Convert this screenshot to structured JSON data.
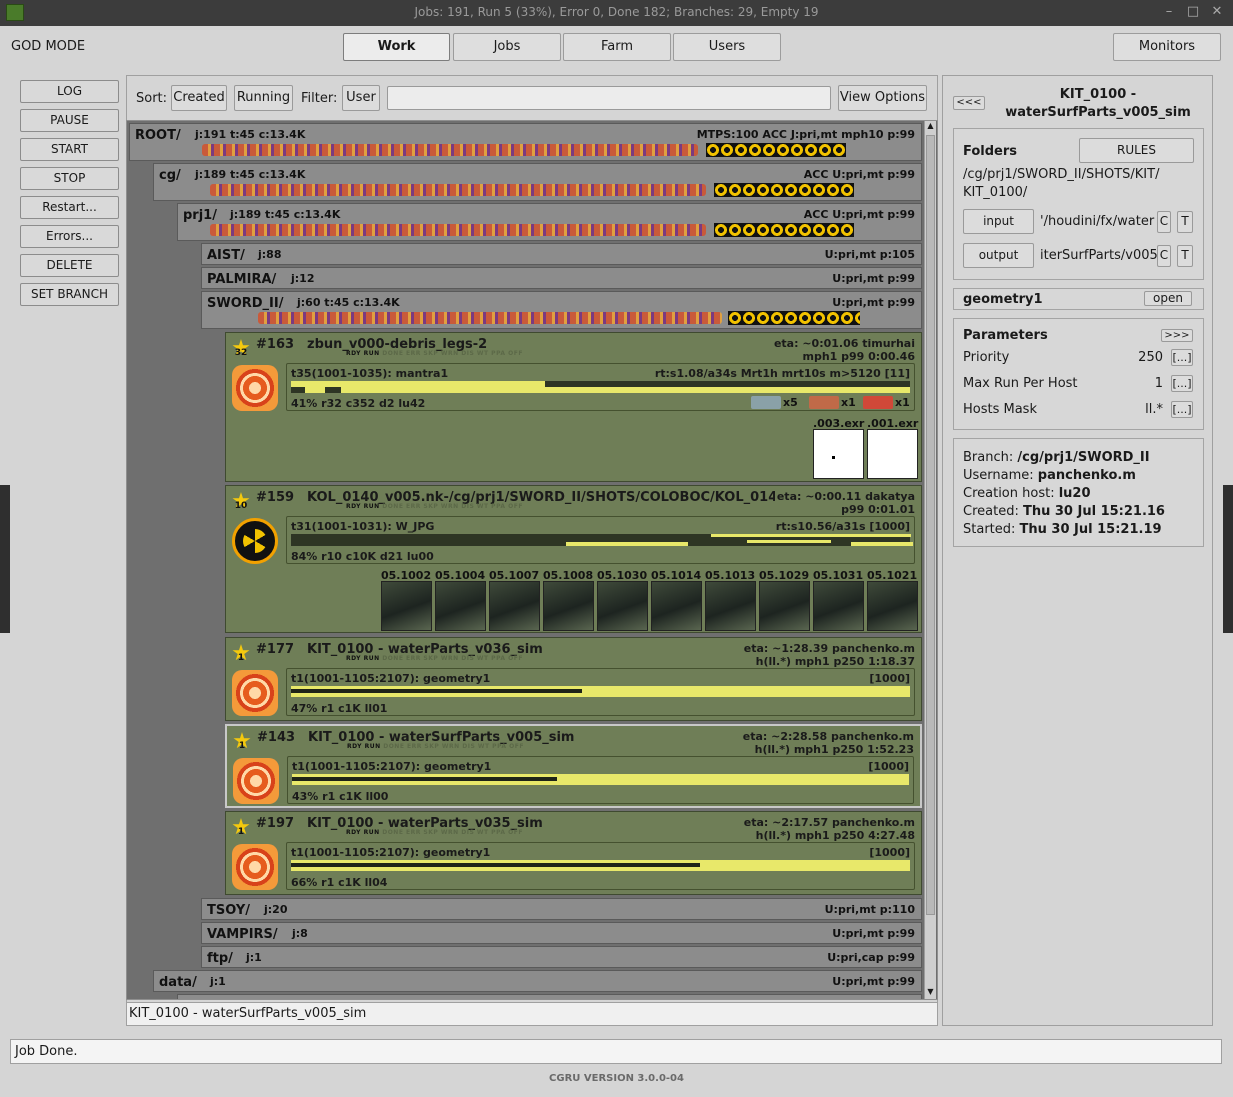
{
  "window": {
    "title": "Jobs: 191, Run 5 (33%), Error 0, Done 182; Branches: 29, Empty 19"
  },
  "header": {
    "mode_label": "GOD MODE",
    "tabs": [
      "Work",
      "Jobs",
      "Farm",
      "Users"
    ],
    "monitors_label": "Monitors"
  },
  "sidebar": {
    "buttons": [
      "LOG",
      "PAUSE",
      "START",
      "STOP",
      "Restart...",
      "Errors...",
      "DELETE",
      "SET BRANCH"
    ]
  },
  "toolbar": {
    "sort_label": "Sort:",
    "sort_created": "Created",
    "sort_running": "Running",
    "filter_label": "Filter:",
    "filter_user": "User",
    "filter_value": "",
    "view_options": "View Options"
  },
  "branches": {
    "root": {
      "name": "ROOT/",
      "info": "j:191 t:45 c:13.4K",
      "right": "MTPS:100 ACC J:pri,mt mph10 p:99"
    },
    "cg": {
      "name": "cg/",
      "info": "j:189 t:45 c:13.4K",
      "right": "ACC U:pri,mt p:99"
    },
    "prj1": {
      "name": "prj1/",
      "info": "j:189 t:45 c:13.4K",
      "right": "ACC U:pri,mt p:99"
    },
    "aist": {
      "name": "AIST/",
      "info": "j:88",
      "right": "U:pri,mt p:105"
    },
    "palmira": {
      "name": "PALMIRA/",
      "info": "j:12",
      "right": "U:pri,mt p:99"
    },
    "sword": {
      "name": "SWORD_II/",
      "info": "j:60 t:45 c:13.4K",
      "right": "U:pri,mt p:99"
    },
    "tsoy": {
      "name": "TSOY/",
      "info": "j:20",
      "right": "U:pri,mt p:110"
    },
    "vampirs": {
      "name": "VAMPIRS/",
      "info": "j:8",
      "right": "U:pri,mt p:99"
    },
    "ftp": {
      "name": "ftp/",
      "info": "j:1",
      "right": "U:pri,cap p:99"
    },
    "data": {
      "name": "data/",
      "info": "j:1",
      "right": "U:pri,mt p:99"
    }
  },
  "jobs": [
    {
      "id": "#163",
      "name": "zbun_v000-debris_legs-2",
      "star": "32",
      "r1": "eta: ~0:01.06 timurhai",
      "r2": "mph1 p99 0:00.46",
      "block": "t35(1001-1035): mantra1",
      "block_right": "rt:s1.08/a34s Mrt1h mrt10s m>5120 [11]",
      "progress": 0.41,
      "foot": "41% r32 c352 d2 lu42",
      "counts": [
        "x5",
        "x1",
        "x1"
      ],
      "thumbs": [
        ".003.exr",
        ".001.exr"
      ]
    },
    {
      "id": "#159",
      "name": "KOL_0140_v005.nk-/cg/prj1/SWORD_II/SHOTS/COLOBOC/KOL_014",
      "star": "10",
      "r1": "eta: ~0:00.11 dakatya",
      "r2": "p99 0:01.01",
      "block": "t31(1001-1031): W_JPG",
      "block_right": "rt:s10.56/a31s [1000]",
      "progress": 0.84,
      "foot": "84% r10 c10K d21 lu00",
      "thumbs": [
        "05.1002",
        "05.1004",
        "05.1007",
        "05.1008",
        "05.1030",
        "05.1014",
        "05.1013",
        "05.1029",
        "05.1031",
        "05.1021"
      ]
    },
    {
      "id": "#177",
      "name": "KIT_0100 - waterParts_v036_sim",
      "star": "1",
      "r1": "eta: ~1:28.39 panchenko.m",
      "r2": "h(ll.*) mph1 p250 1:18.37",
      "block": "t1(1001-1105:2107): geometry1",
      "block_right": "[1000]",
      "progress": 0.47,
      "foot": "47% r1 c1K ll01"
    },
    {
      "id": "#143",
      "name": "KIT_0100 - waterSurfParts_v005_sim",
      "star": "1",
      "r1": "eta: ~2:28.58 panchenko.m",
      "r2": "h(ll.*) mph1 p250 1:52.23",
      "block": "t1(1001-1105:2107): geometry1",
      "block_right": "[1000]",
      "progress": 0.43,
      "foot": "43% r1 c1K ll00"
    },
    {
      "id": "#197",
      "name": "KIT_0100 - waterParts_v035_sim",
      "star": "1",
      "r1": "eta: ~2:17.57 panchenko.m",
      "r2": "h(ll.*) mph1 p250 4:27.48",
      "block": "t1(1001-1105:2107): geometry1",
      "block_right": "[1000]",
      "progress": 0.66,
      "foot": "66% r1 c1K ll04"
    }
  ],
  "job_flags": {
    "rdy": "RDY",
    "run": "RUN",
    "rest": "DONE ERR SKP WRN DIS  WT  PPA OFF"
  },
  "selected_label": "KIT_0100 - waterSurfParts_v005_sim",
  "right": {
    "collapse": "<<<",
    "title": "KIT_0100 - waterSurfParts_v005_sim",
    "folders_label": "Folders",
    "rules": "RULES",
    "folder_path": "/cg/prj1/SWORD_II/SHOTS/KIT/\nKIT_0100/",
    "input_label": "input",
    "input_path": "'/houdini/fx/water",
    "output_label": "output",
    "output_path": "iterSurfParts/v005",
    "c": "C",
    "t": "T",
    "block_name": "geometry1",
    "open": "open",
    "params_label": "Parameters",
    "expand": ">>>",
    "params": [
      {
        "name": "Priority",
        "value": "250"
      },
      {
        "name": "Max Run Per Host",
        "value": "1"
      },
      {
        "name": "Hosts Mask",
        "value": "ll.*"
      }
    ],
    "edit": "[...]",
    "info": [
      {
        "k": "Branch:",
        "v": "/cg/prj1/SWORD_II"
      },
      {
        "k": "Username:",
        "v": "panchenko.m"
      },
      {
        "k": "Creation host:",
        "v": "lu20"
      },
      {
        "k": "Created:",
        "v": "Thu 30 Jul 15:21.16"
      },
      {
        "k": "Started:",
        "v": "Thu 30 Jul 15:21.19"
      }
    ]
  },
  "status": "Job Done.",
  "version": "CGRU VERSION 3.0.0-04"
}
